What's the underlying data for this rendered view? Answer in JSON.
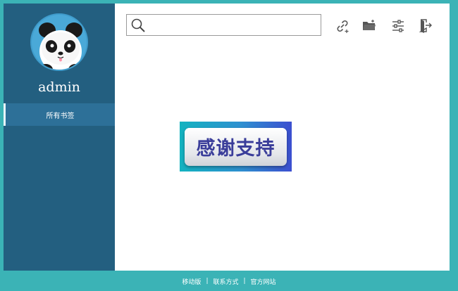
{
  "user": {
    "name": "admin",
    "avatar": "panda-avatar"
  },
  "sidebar": {
    "items": [
      {
        "label": "所有书签",
        "active": true
      }
    ]
  },
  "search": {
    "value": "",
    "placeholder": "",
    "icon": "search-icon"
  },
  "toolbar": {
    "icons": [
      "add-link-icon",
      "add-folder-icon",
      "settings-sliders-icon",
      "logout-icon"
    ]
  },
  "banner": {
    "label": "感谢支持"
  },
  "footer": {
    "links": [
      "移动版",
      "联系方式",
      "官方网站"
    ],
    "separator": "|"
  },
  "colors": {
    "background": "#3bb3b6",
    "sidebar": "#235f80",
    "sidebar_active": "#2d7098",
    "banner_text": "#3a3d9a"
  }
}
